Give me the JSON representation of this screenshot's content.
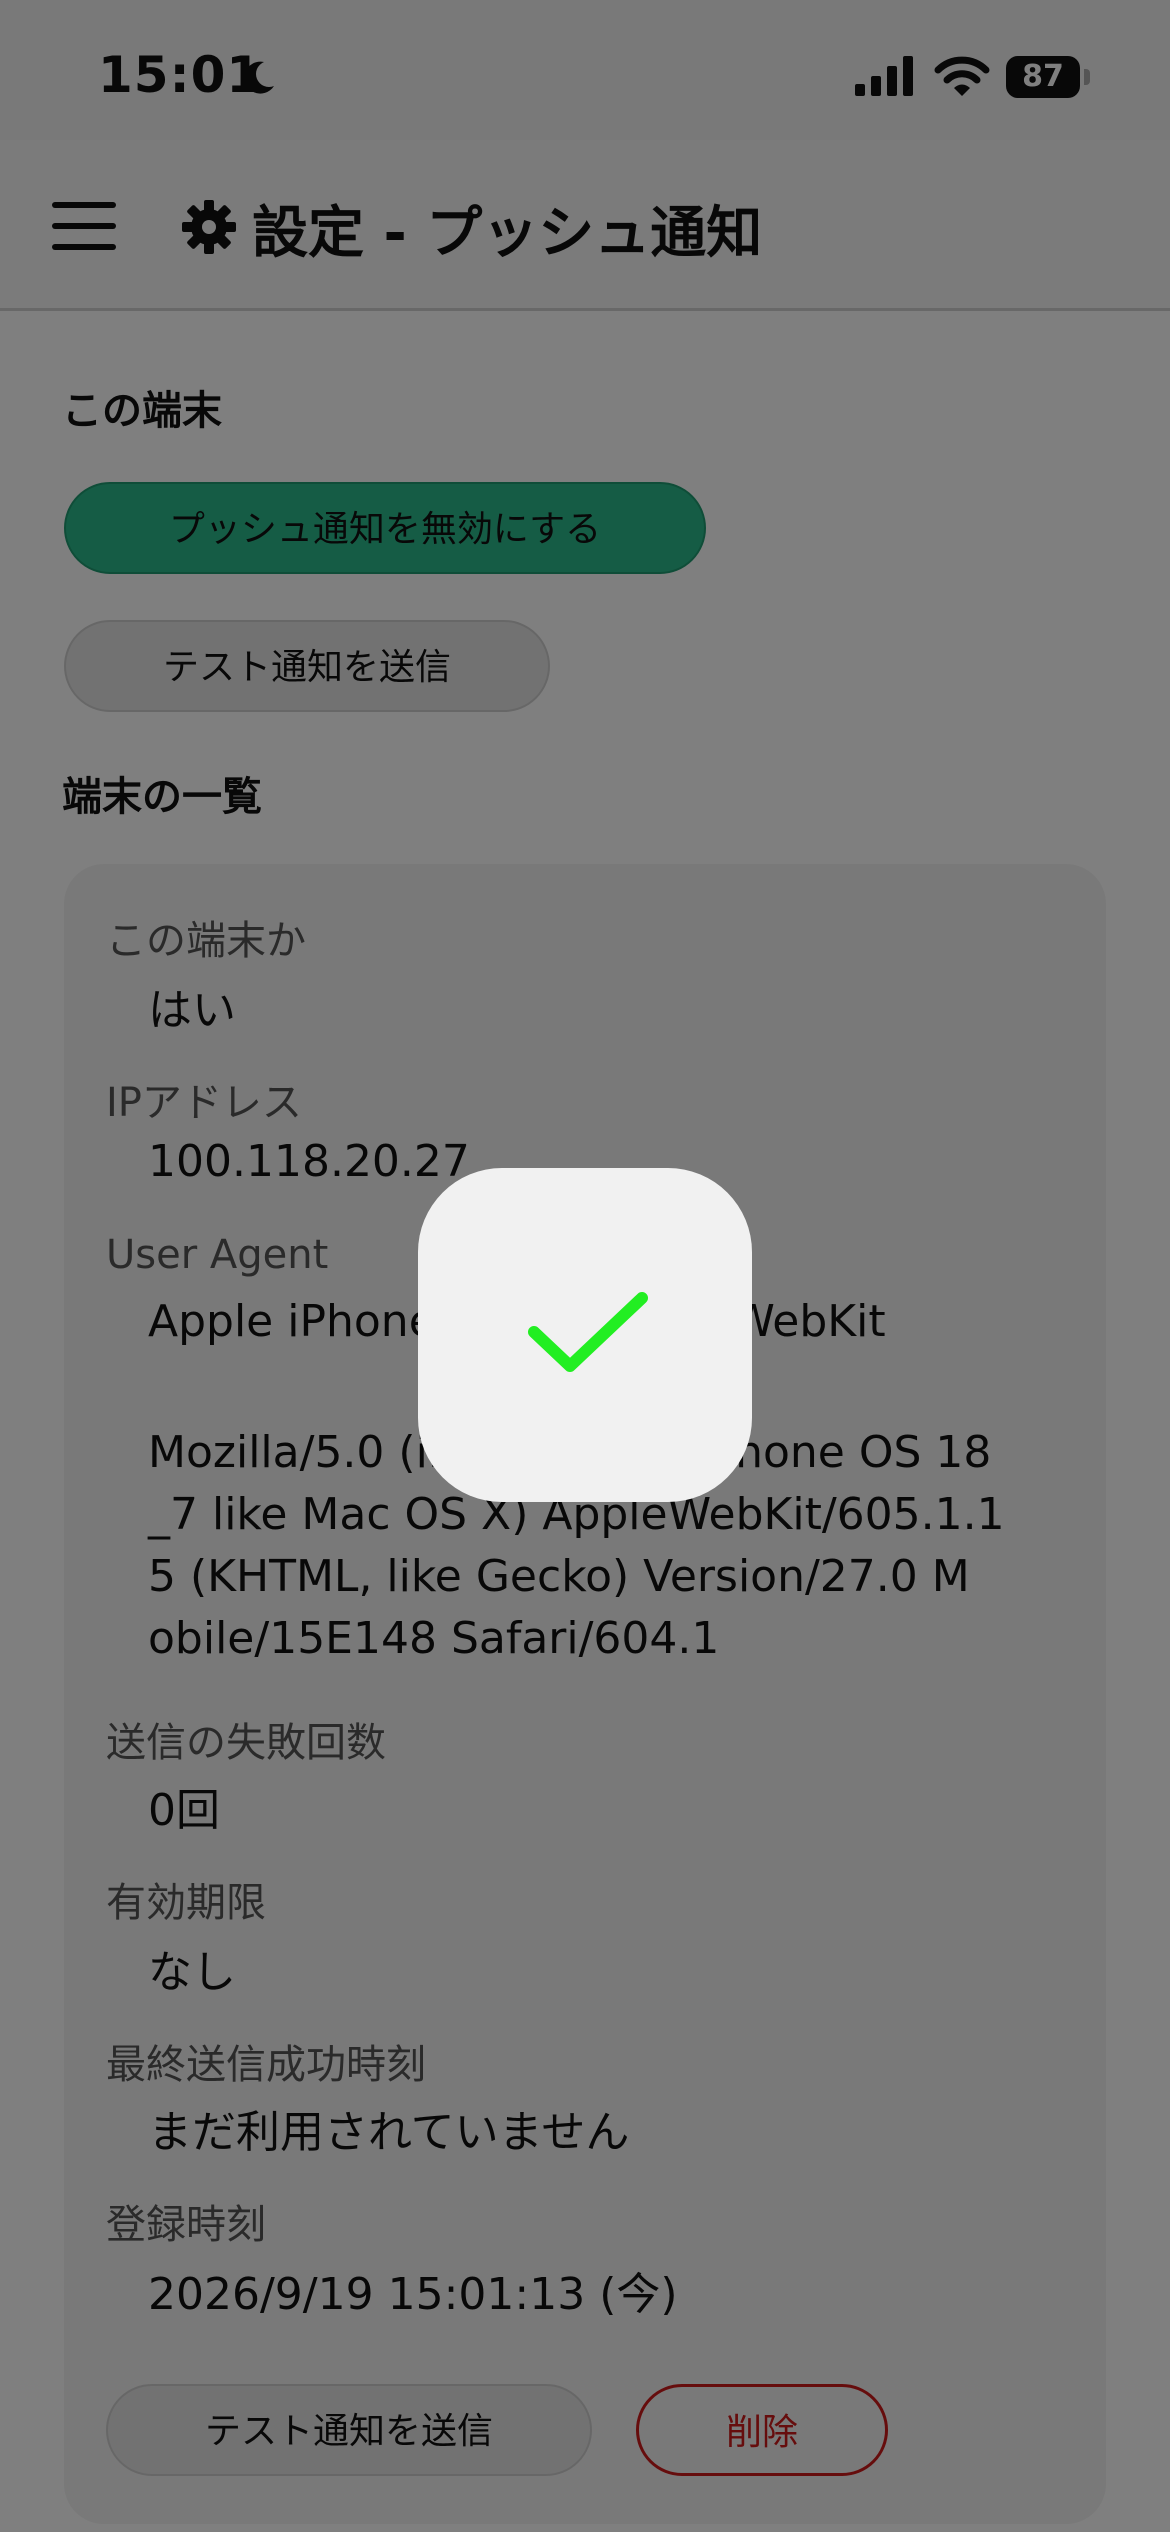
{
  "status_bar": {
    "time": "15:01",
    "battery_percent": "87",
    "icons": [
      "moon-icon",
      "signal-icon",
      "wifi-icon",
      "battery-icon"
    ]
  },
  "app_bar": {
    "title": "設定 - プッシュ通知",
    "icons": [
      "menu-icon",
      "gear-icon"
    ]
  },
  "this_device": {
    "section_title": "この端末",
    "disable_push_label": "プッシュ通知を無効にする",
    "send_test_label": "テスト通知を送信"
  },
  "device_list": {
    "section_title": "端末の一覧",
    "devices": [
      {
        "is_this_device_label": "この端末か",
        "is_this_device_value": "はい",
        "ip_label": "IPアドレス",
        "ip_value": "100.118.20.27",
        "ua_label": "User Agent",
        "ua_summary": "Apple iPhone · Safari 27.0·WebKit",
        "ua_full_lines": [
          "Mozilla/5.0 (iPhone; CPU iPhone OS 18",
          "_7 like Mac OS X) AppleWebKit/605.1.1",
          "5 (KHTML, like Gecko) Version/27.0 M",
          "obile/15E148 Safari/604.1"
        ],
        "fail_count_label": "送信の失敗回数",
        "fail_count_value": "0回",
        "expiry_label": "有効期限",
        "expiry_value": "なし",
        "last_success_label": "最終送信成功時刻",
        "last_success_value": "まだ利用されていません",
        "registered_label": "登録時刻",
        "registered_value": "2026/9/19 15:01:13 (今)",
        "send_test_label": "テスト通知を送信",
        "delete_label": "削除"
      }
    ]
  },
  "toast": {
    "icon": "checkmark-icon",
    "check_color": "#22ee22"
  },
  "colors": {
    "primary_button": "#2bb98a",
    "delete": "#cc1a1a",
    "overlay": "rgba(0,0,0,0.5)"
  }
}
